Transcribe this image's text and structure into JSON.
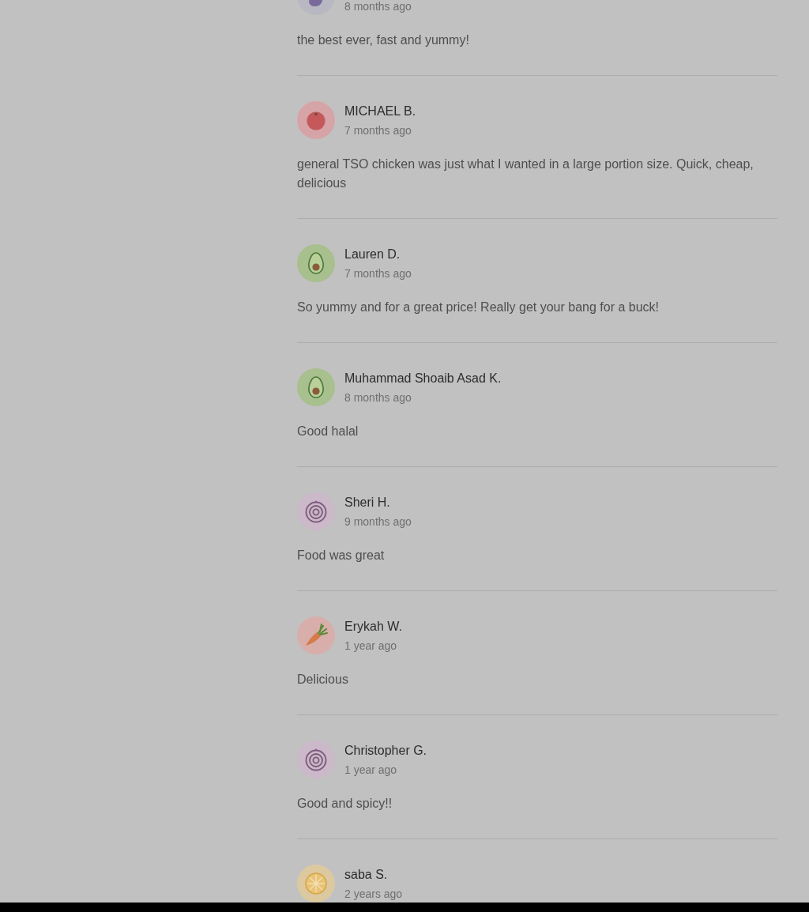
{
  "reviews": [
    {
      "avatar": {
        "kind": "eggplant"
      },
      "date": "8 months ago",
      "text": "the best ever, fast and yummy!"
    },
    {
      "avatar": {
        "kind": "tomato"
      },
      "name": "MICHAEL B.",
      "date": "7 months ago",
      "text": "general TSO chicken was just what I wanted in a large portion size. Quick, cheap, delicious"
    },
    {
      "avatar": {
        "kind": "avocado"
      },
      "name": "Lauren D.",
      "date": "7 months ago",
      "text": "So yummy and for a great price! Really get your bang for a buck!"
    },
    {
      "avatar": {
        "kind": "avocado"
      },
      "name": "Muhammad Shoaib Asad K.",
      "date": "8 months ago",
      "text": "Good halal"
    },
    {
      "avatar": {
        "kind": "onion"
      },
      "name": "Sheri H.",
      "date": "9 months ago",
      "text": "Food was great"
    },
    {
      "avatar": {
        "kind": "carrot"
      },
      "name": "Erykah W.",
      "date": "1 year ago",
      "text": "Delicious"
    },
    {
      "avatar": {
        "kind": "onion"
      },
      "name": "Christopher G.",
      "date": "1 year ago",
      "text": "Good and spicy!!"
    },
    {
      "avatar": {
        "kind": "citrus"
      },
      "name": "saba S.",
      "date": "2 years ago"
    }
  ]
}
